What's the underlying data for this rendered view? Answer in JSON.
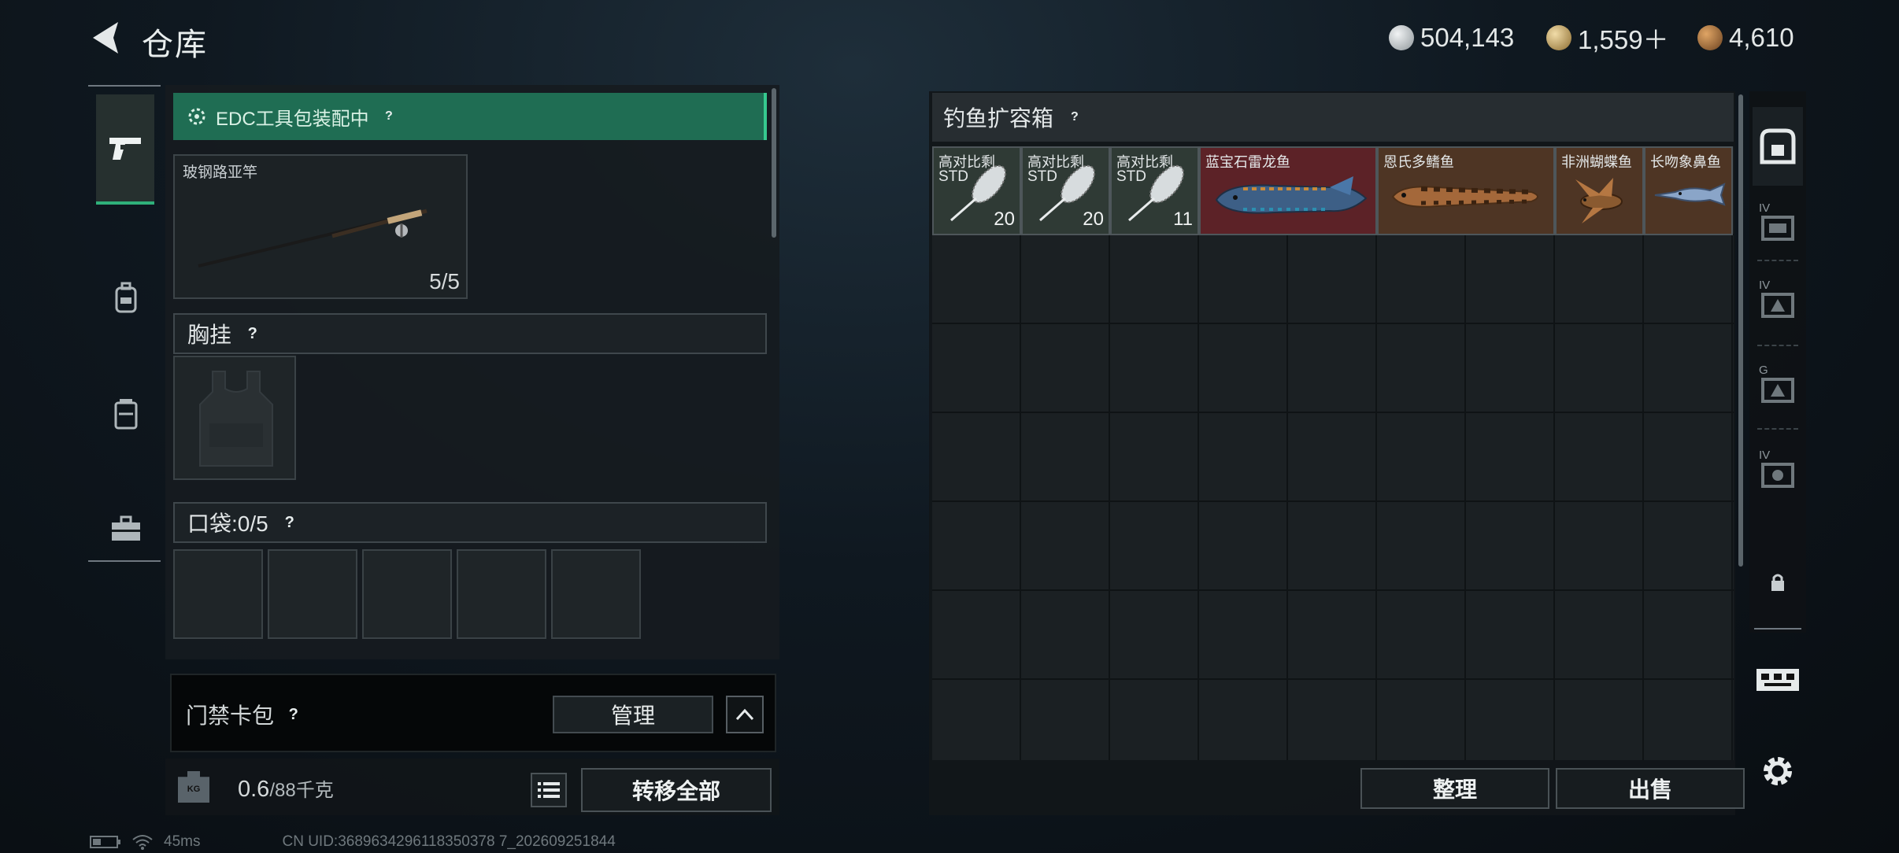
{
  "header": {
    "title": "仓库",
    "currencies": [
      {
        "icon": "silver-coin-icon",
        "value": "504,143",
        "color": "#c9ced1"
      },
      {
        "icon": "gold-coin-icon",
        "value": "1,559＋",
        "color": "#c8a86a"
      },
      {
        "icon": "bronze-coin-icon",
        "value": "4,610",
        "color": "#b07a3e"
      }
    ]
  },
  "left_panel": {
    "edc": {
      "label": "EDC工具包装配中",
      "help": "?"
    },
    "rod": {
      "name": "玻钢路亚竿",
      "count": "5/5"
    },
    "chest_rig": {
      "label": "胸挂",
      "help": "?"
    },
    "pocket": {
      "label": "口袋:",
      "count": "0/5",
      "help": "?",
      "slots": 5
    },
    "keycard": {
      "label": "门禁卡包",
      "help": "?",
      "manage": "管理"
    },
    "weight": {
      "current": "0.6",
      "capacity": "/88千克",
      "kg_icon_label": "KG"
    },
    "transfer_all": "转移全部"
  },
  "container": {
    "title": "钓鱼扩容箱",
    "help": "?",
    "items": [
      {
        "name": "高对比剩",
        "sub": "STD",
        "count": "20",
        "color": "#2f3a35"
      },
      {
        "name": "高对比剩",
        "sub": "STD",
        "count": "20",
        "color": "#2f3a35"
      },
      {
        "name": "高对比剩",
        "sub": "STD",
        "count": "11",
        "color": "#2f3a35"
      },
      {
        "name": "蓝宝石雷龙鱼",
        "sub": "",
        "count": "",
        "color": "#5c2227"
      },
      {
        "name": "恩氏多鳍鱼",
        "sub": "",
        "count": "",
        "color": "#4e3524"
      },
      {
        "name": "非洲蝴蝶鱼",
        "sub": "",
        "count": "",
        "color": "#4e3524"
      },
      {
        "name": "长吻象鼻鱼",
        "sub": "",
        "count": "",
        "color": "#4e3524"
      }
    ],
    "sort": "整理",
    "sell": "出售"
  },
  "right_rail": {
    "tiers": [
      "IV",
      "IV",
      "G",
      "IV"
    ]
  },
  "status": {
    "ping": "45ms",
    "uid": "CN UID:3689634296118350378 7_202609251844"
  },
  "colors": {
    "accent": "#36c98f",
    "edc_bg": "#1f6d53"
  }
}
